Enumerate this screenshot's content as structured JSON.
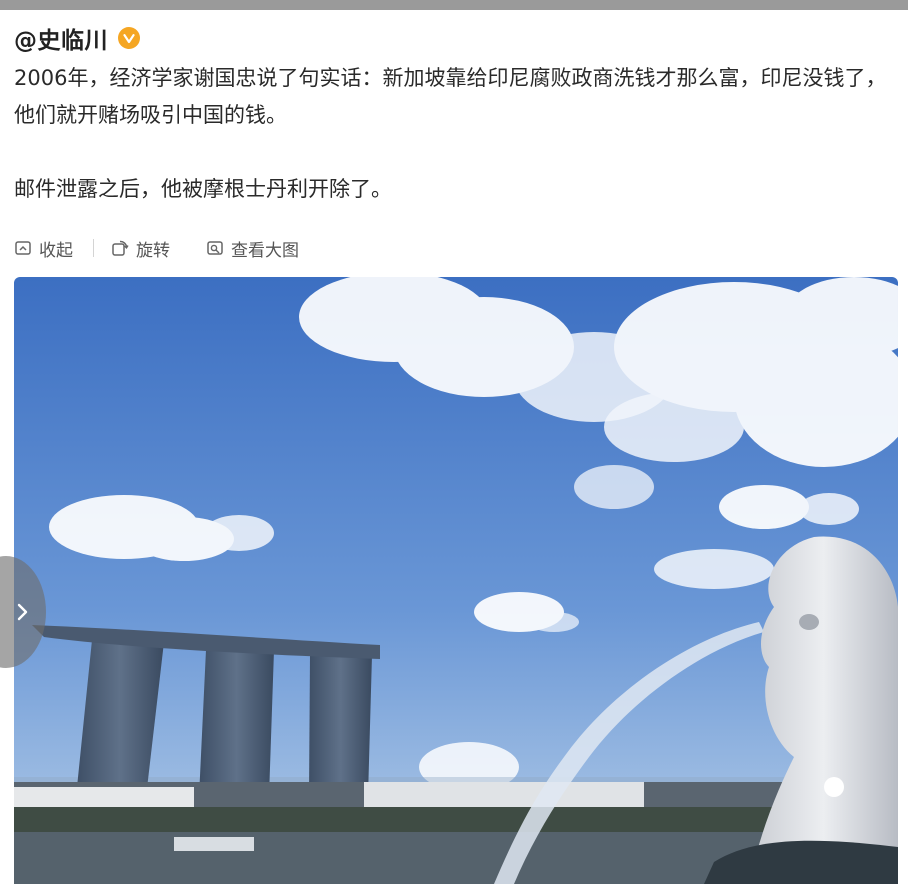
{
  "post": {
    "author": "@史临川",
    "paragraphs": [
      "2006年，经济学家谢国忠说了句实话：新加坡靠给印尼腐败政商洗钱才那么富，印尼没钱了，他们就开赌场吸引中国的钱。",
      "邮件泄露之后，他被摩根士丹利开除了。"
    ]
  },
  "actions": {
    "collapse_label": "收起",
    "rotate_label": "旋转",
    "view_large_label": "查看大图"
  },
  "icons": {
    "verified": "verified-badge-icon",
    "collapse": "collapse-icon",
    "rotate": "rotate-icon",
    "view_large": "view-large-icon",
    "prev": "chevron-right-icon"
  },
  "colors": {
    "verified_badge": "#f5a623",
    "text": "#2a2a2a",
    "action_text": "#555555",
    "sky_top": "#3f72c4",
    "sky_bottom": "#a8c5e6",
    "water": "#56636f"
  }
}
